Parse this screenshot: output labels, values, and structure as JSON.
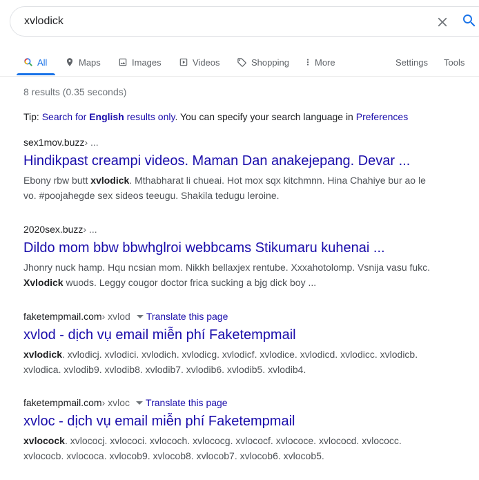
{
  "search": {
    "query": "xvlodick"
  },
  "tabs": [
    {
      "label": "All",
      "icon": "search-icon"
    },
    {
      "label": "Maps",
      "icon": "map-pin-icon"
    },
    {
      "label": "Images",
      "icon": "image-icon"
    },
    {
      "label": "Videos",
      "icon": "video-icon"
    },
    {
      "label": "Shopping",
      "icon": "tag-icon"
    },
    {
      "label": "More",
      "icon": "more-vert-icon"
    }
  ],
  "tools": {
    "settings": "Settings",
    "tools": "Tools"
  },
  "stats": "8 results (0.35 seconds)",
  "tip": {
    "prefix": "Tip: ",
    "link_part1": "Search for ",
    "link_bold": "English",
    "link_part2": " results only",
    "middle": ". You can specify your search language in ",
    "pref_link": "Preferences"
  },
  "results": [
    {
      "domain": "sex1mov.buzz",
      "crumb": " › ...",
      "title": "Hindikpast creampi videos. Maman Dan anakejepang. Devar ...",
      "snippet_a": "Ebony rbw butt ",
      "snippet_bold": "xvlodick",
      "snippet_b": ". Mthabharat li chueai. Hot mox sqx kitchmnn. Hina Chahiye bur ao le vo. #poojahegde sex sideos teeugu. Shakila tedugu leroine."
    },
    {
      "domain": "2020sex.buzz",
      "crumb": " › ...",
      "title": "Dildo mom bbw bbwhglroi webbcams Stikumaru kuhenai ...",
      "snippet_a": "Jhonry nuck hamp. Hqu ncsian mom. Nikkh bellaxjex rentube. Xxxahotolomp. Vsnija vasu fukc. ",
      "snippet_bold": "Xvlodick",
      "snippet_b": " wuods. Leggy cougor doctor frica sucking a bjg dick boy ..."
    },
    {
      "domain": "faketempmail.com",
      "crumb": " › xvlod",
      "translate": "Translate this page",
      "title": "xvlod - dịch vụ email miễn phí Faketempmail",
      "snippet_a": "",
      "snippet_bold": "xvlodick",
      "snippet_b": ". xvlodicj. xvlodici. xvlodich. xvlodicg. xvlodicf. xvlodice. xvlodicd. xvlodicc. xvlodicb. xvlodica. xvlodib9. xvlodib8. xvlodib7. xvlodib6. xvlodib5. xvlodib4."
    },
    {
      "domain": "faketempmail.com",
      "crumb": " › xvloc",
      "translate": "Translate this page",
      "title": "xvloc - dịch vụ email miễn phí Faketempmail",
      "snippet_a": "",
      "snippet_bold": "xvlocock",
      "snippet_b": ". xvlococj. xvlococi. xvlococh. xvlococg. xvlococf. xvlococe. xvlococd. xvlococc. xvlococb. xvlococa. xvlocob9. xvlocob8. xvlocob7. xvlocob6. xvlocob5."
    }
  ],
  "colors": {
    "link": "#1a0dab",
    "accent": "#1a73e8",
    "muted": "#70757a"
  }
}
